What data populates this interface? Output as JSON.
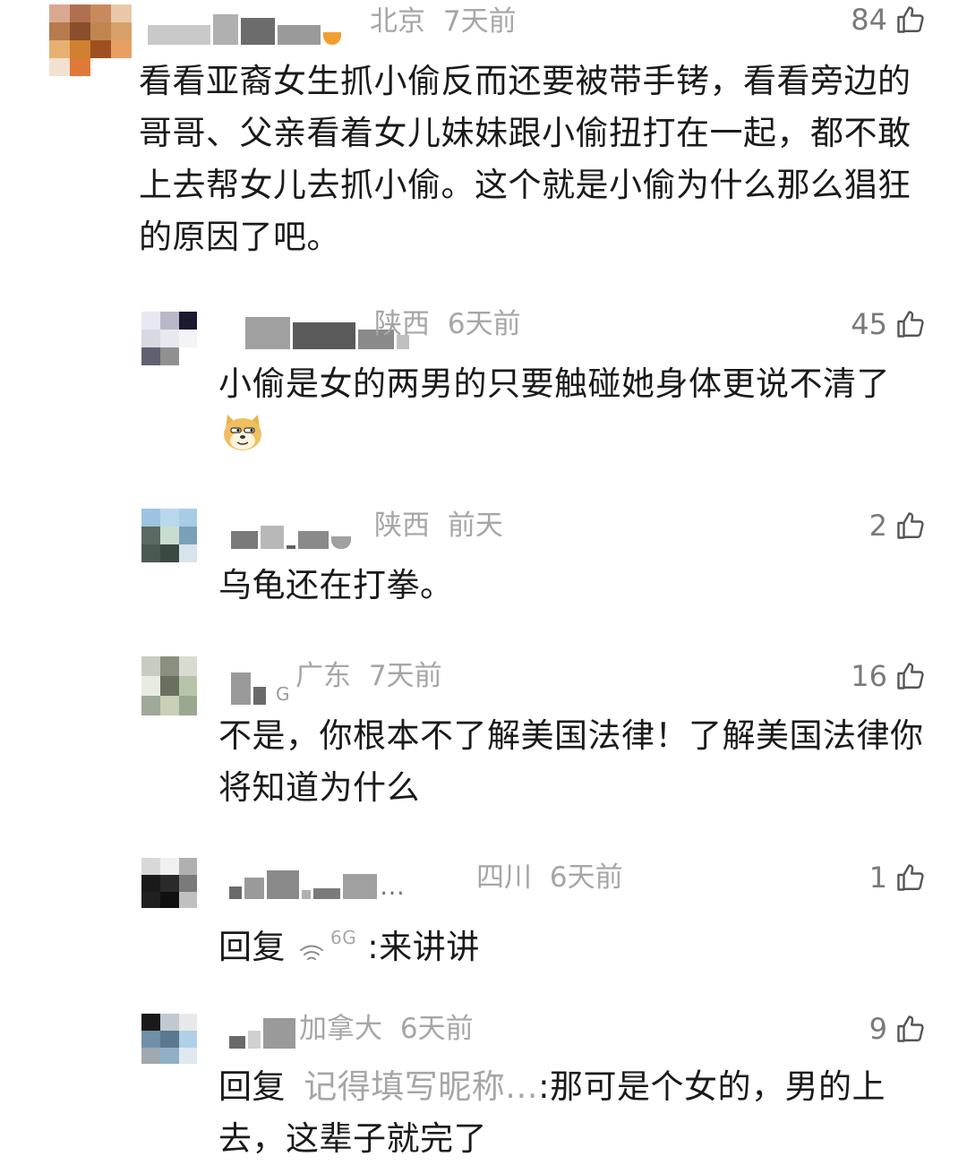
{
  "comments": [
    {
      "region": "北京",
      "time": "7天前",
      "likes": "84",
      "text": "看看亚裔女生抓小偷反而还要被带手铐，看看旁边的哥哥、父亲看着女儿妹妹跟小偷扭打在一起，都不敢上去帮女儿去抓小偷。这个就是小偷为什么那么猖狂的原因了吧。"
    },
    {
      "region": "陕西",
      "time": "6天前",
      "likes": "45",
      "text": "小偷是女的两男的只要触碰她身体更说不清了",
      "emoji": "doge-emoji"
    },
    {
      "region": "陕西",
      "time": "前天",
      "likes": "2",
      "text": "乌龟还在打拳。"
    },
    {
      "nick_suffix": "G",
      "region": "广东",
      "time": "7天前",
      "likes": "16",
      "text": "不是，你根本不了解美国法律！了解美国法律你将知道为什么"
    },
    {
      "nick_suffix": "…",
      "region": "四川",
      "time": "6天前",
      "likes": "1",
      "reply_prefix": "回复",
      "reply_nick": "6G",
      "reply_text": ":来讲讲"
    },
    {
      "region": "加拿大",
      "time": "6天前",
      "likes": "9",
      "reply_prefix": "回复",
      "reply_nick": "记得填写昵称...",
      "reply_text": ":那可是个女的，男的上去，这辈子就完了"
    }
  ],
  "icons": {
    "like": "thumbs-up-icon"
  },
  "colors": {
    "meta": "#a6a6a6",
    "text": "#1a1a1a",
    "background": "#ffffff"
  }
}
